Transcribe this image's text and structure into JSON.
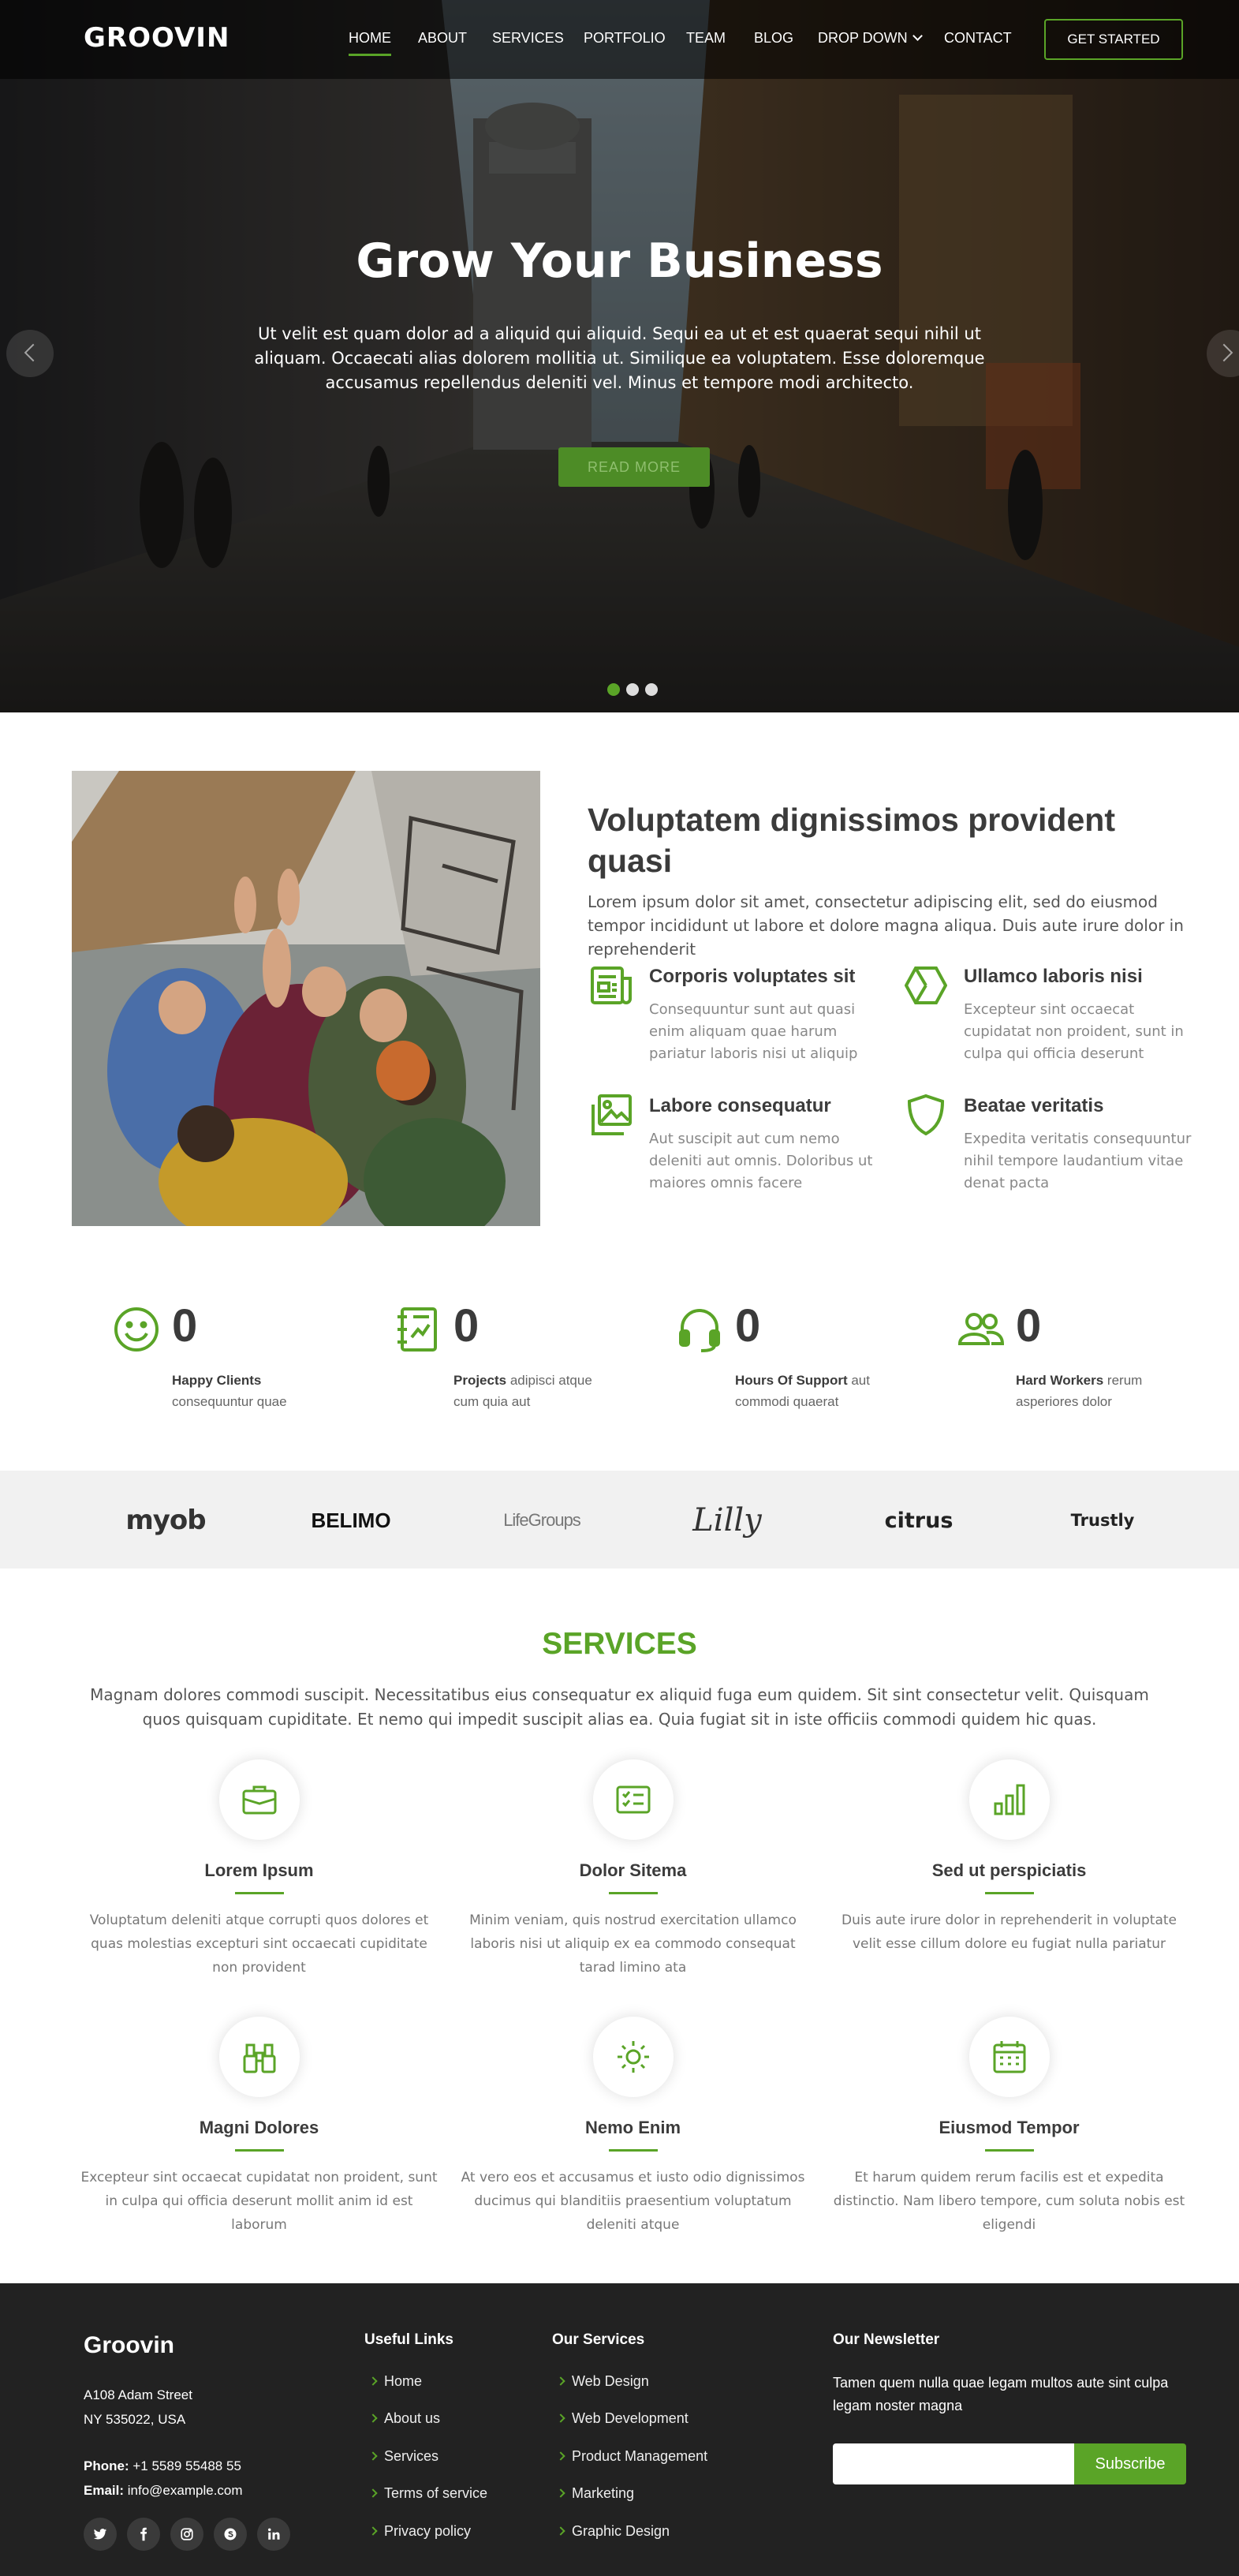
{
  "header": {
    "logo": "GROOVIN",
    "nav": [
      "HOME",
      "ABOUT",
      "SERVICES",
      "PORTFOLIO",
      "TEAM",
      "BLOG",
      "DROP DOWN",
      "CONTACT"
    ],
    "cta": "GET STARTED"
  },
  "hero": {
    "title": "Grow Your Business",
    "text": "Ut velit est quam dolor ad a aliquid qui aliquid. Sequi ea ut et est quaerat sequi nihil ut aliquam. Occaecati alias dolorem mollitia ut. Similique ea voluptatem. Esse doloremque accusamus repellendus deleniti vel. Minus et tempore modi architecto.",
    "button": "READ MORE",
    "slides": 3,
    "active_slide": 1
  },
  "about": {
    "title": "Voluptatem dignissimos provident quasi",
    "text": "Lorem ipsum dolor sit amet, consectetur adipiscing elit, sed do eiusmod tempor incididunt ut labore et dolore magna aliqua. Duis aute irure dolor in reprehenderit",
    "features": [
      {
        "icon": "receipt-icon",
        "title": "Corporis voluptates sit",
        "text": "Consequuntur sunt aut quasi enim aliquam quae harum pariatur laboris nisi ut aliquip"
      },
      {
        "icon": "cube-icon",
        "title": "Ullamco laboris nisi",
        "text": "Excepteur sint occaecat cupidatat non proident, sunt in culpa qui officia deserunt"
      },
      {
        "icon": "images-icon",
        "title": "Labore consequatur",
        "text": "Aut suscipit aut cum nemo deleniti aut omnis. Doloribus ut maiores omnis facere"
      },
      {
        "icon": "shield-icon",
        "title": "Beatae veritatis",
        "text": "Expedita veritatis consequuntur nihil tempore laudantium vitae denat pacta"
      }
    ]
  },
  "counts": [
    {
      "icon": "smile-icon",
      "value": "0",
      "label": "Happy Clients",
      "text": "consequuntur quae"
    },
    {
      "icon": "journal-icon",
      "value": "0",
      "label": "Projects",
      "text": "adipisci atque cum quia aut"
    },
    {
      "icon": "headset-icon",
      "value": "0",
      "label": "Hours Of Support",
      "text": "aut commodi quaerat"
    },
    {
      "icon": "people-icon",
      "value": "0",
      "label": "Hard Workers",
      "text": "rerum asperiores dolor"
    }
  ],
  "clients": [
    "myob",
    "BELIMO",
    "LifeGroups",
    "Lilly",
    "citrus",
    "Trustly"
  ],
  "services": {
    "title": "SERVICES",
    "subtitle": "Magnam dolores commodi suscipit. Necessitatibus eius consequatur ex aliquid fuga eum quidem. Sit sint consectetur velit. Quisquam quos quisquam cupiditate. Et nemo qui impedit suscipit alias ea. Quia fugiat sit in iste officiis commodi quidem hic quas.",
    "items": [
      {
        "icon": "briefcase-icon",
        "title": "Lorem Ipsum",
        "text": "Voluptatum deleniti atque corrupti quos dolores et quas molestias excepturi sint occaecati cupiditate non provident"
      },
      {
        "icon": "card-checklist-icon",
        "title": "Dolor Sitema",
        "text": "Minim veniam, quis nostrud exercitation ullamco laboris nisi ut aliquip ex ea commodo consequat tarad limino ata"
      },
      {
        "icon": "bar-chart-icon",
        "title": "Sed ut perspiciatis",
        "text": "Duis aute irure dolor in reprehenderit in voluptate velit esse cillum dolore eu fugiat nulla pariatur"
      },
      {
        "icon": "binoculars-icon",
        "title": "Magni Dolores",
        "text": "Excepteur sint occaecat cupidatat non proident, sunt in culpa qui officia deserunt mollit anim id est laborum"
      },
      {
        "icon": "brightness-icon",
        "title": "Nemo Enim",
        "text": "At vero eos et accusamus et iusto odio dignissimos ducimus qui blanditiis praesentium voluptatum deleniti atque"
      },
      {
        "icon": "calendar-icon",
        "title": "Eiusmod Tempor",
        "text": "Et harum quidem rerum facilis est et expedita distinctio. Nam libero tempore, cum soluta nobis est eligendi"
      }
    ]
  },
  "footer": {
    "brand": "Groovin",
    "address_line1": "A108 Adam Street",
    "address_line2": "NY 535022, USA",
    "phone_label": "Phone:",
    "phone": "+1 5589 55488 55",
    "email_label": "Email:",
    "email": "info@example.com",
    "social": [
      "twitter-icon",
      "facebook-icon",
      "instagram-icon",
      "skype-icon",
      "linkedin-icon"
    ],
    "useful_links_title": "Useful Links",
    "useful_links": [
      "Home",
      "About us",
      "Services",
      "Terms of service",
      "Privacy policy"
    ],
    "services_title": "Our Services",
    "services_links": [
      "Web Design",
      "Web Development",
      "Product Management",
      "Marketing",
      "Graphic Design"
    ],
    "newsletter_title": "Our Newsletter",
    "newsletter_text": "Tamen quem nulla quae legam multos aute sint culpa legam noster magna",
    "newsletter_placeholder": "",
    "newsletter_button": "Subscribe"
  },
  "colors": {
    "accent": "#5aa427",
    "footer_bg": "#222222",
    "clients_bg": "#f1f1f1"
  }
}
